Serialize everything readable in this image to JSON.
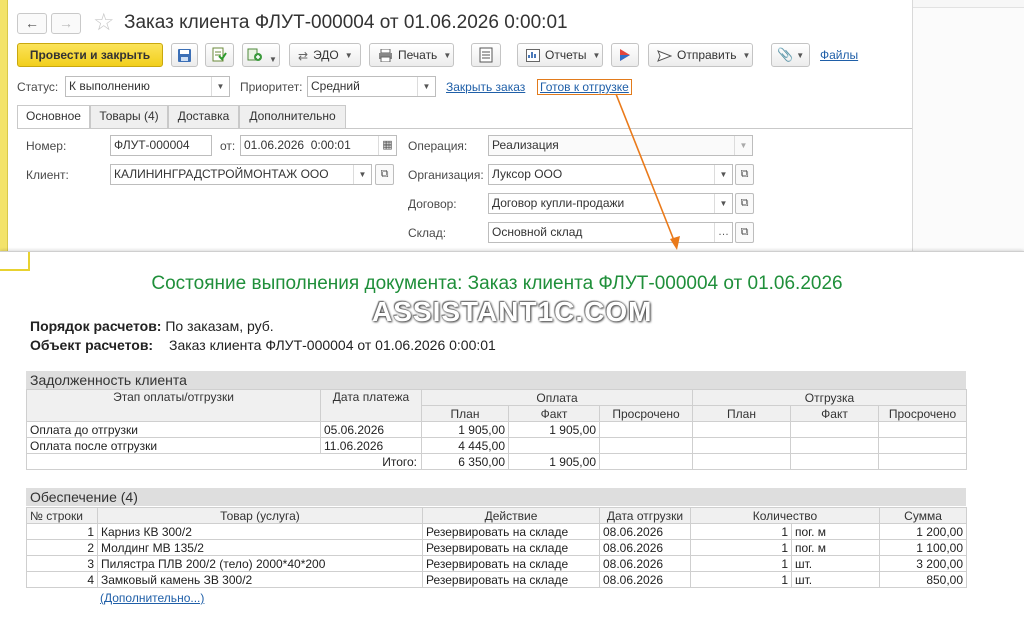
{
  "window": {
    "title": "Заказ клиента ФЛУТ-000004 от 01.06.2026 0:00:01"
  },
  "toolbar": {
    "post_close": "Провести и закрыть",
    "edo": "ЭДО",
    "print": "Печать",
    "reports": "Отчеты",
    "send": "Отправить",
    "files": "Файлы"
  },
  "status_row": {
    "status_label": "Статус:",
    "status_value": "К выполнению",
    "priority_label": "Приоритет:",
    "priority_value": "Средний",
    "close_order_link": "Закрыть заказ",
    "ready_link": "Готов к отгрузке"
  },
  "tabs": [
    "Основное",
    "Товары (4)",
    "Доставка",
    "Дополнительно"
  ],
  "main": {
    "number_label": "Номер:",
    "number_value": "ФЛУТ-000004",
    "date_label": "от:",
    "date_value": "01.06.2026  0:00:01",
    "client_label": "Клиент:",
    "client_value": "КАЛИНИНГРАДСТРОЙМОНТАЖ ООО",
    "operation_label": "Операция:",
    "operation_value": "Реализация",
    "org_label": "Организация:",
    "org_value": "Луксор ООО",
    "contract_label": "Договор:",
    "contract_value": "Договор купли-продажи",
    "warehouse_label": "Склад:",
    "warehouse_value": "Основной склад"
  },
  "report": {
    "title": "Состояние выполнения документа: Заказ клиента ФЛУТ-000004 от 01.06.2026",
    "watermark": "ASSISTANT1C.COM",
    "settlement_label": "Порядок расчетов:",
    "settlement_value": "По заказам, руб.",
    "object_label": "Объект расчетов:",
    "object_value": "Заказ клиента ФЛУТ-000004 от 01.06.2026 0:00:01",
    "debt_section": "Задолженность клиента",
    "debt_headers": {
      "stage": "Этап оплаты/отгрузки",
      "pay_date": "Дата платежа",
      "payment": "Оплата",
      "shipment": "Отгрузка",
      "plan": "План",
      "fact": "Факт",
      "overdue": "Просрочено"
    },
    "debt_rows": [
      {
        "stage": "Оплата до отгрузки",
        "date": "05.06.2026",
        "pay_plan": "1 905,00",
        "pay_fact": "1 905,00",
        "pay_overdue": "",
        "ship_plan": "",
        "ship_fact": "",
        "ship_overdue": ""
      },
      {
        "stage": "Оплата после отгрузки",
        "date": "11.06.2026",
        "pay_plan": "4 445,00",
        "pay_fact": "",
        "pay_overdue": "",
        "ship_plan": "",
        "ship_fact": "",
        "ship_overdue": ""
      }
    ],
    "debt_total": {
      "label": "Итого:",
      "pay_plan": "6 350,00",
      "pay_fact": "1 905,00"
    },
    "supply_section": "Обеспечение (4)",
    "supply_headers": {
      "row_no": "№ строки",
      "item": "Товар (услуга)",
      "action": "Действие",
      "ship_date": "Дата отгрузки",
      "qty": "Количество",
      "sum": "Сумма"
    },
    "supply_rows": [
      {
        "n": "1",
        "item": "Карниз КВ 300/2",
        "action": "Резервировать на складе",
        "date": "08.06.2026",
        "qty": "1",
        "unit": "пог. м",
        "sum": "1 200,00"
      },
      {
        "n": "2",
        "item": "Молдинг МВ 135/2",
        "action": "Резервировать на складе",
        "date": "08.06.2026",
        "qty": "1",
        "unit": "пог. м",
        "sum": "1 100,00"
      },
      {
        "n": "3",
        "item": "Пилястра ПЛВ 200/2 (тело) 2000*40*200",
        "action": "Резервировать на складе",
        "date": "08.06.2026",
        "qty": "1",
        "unit": "шт.",
        "sum": "3 200,00"
      },
      {
        "n": "4",
        "item": "Замковый камень ЗВ 300/2",
        "action": "Резервировать на складе",
        "date": "08.06.2026",
        "qty": "1",
        "unit": "шт.",
        "sum": "850,00"
      }
    ],
    "more_link": "(Дополнительно...)"
  }
}
